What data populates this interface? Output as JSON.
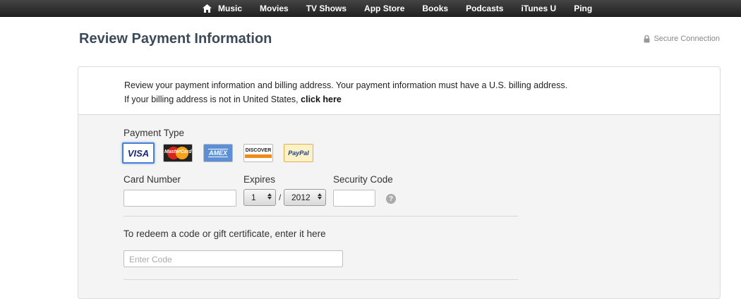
{
  "nav": {
    "items": [
      "Music",
      "Movies",
      "TV Shows",
      "App Store",
      "Books",
      "Podcasts",
      "iTunes U",
      "Ping"
    ]
  },
  "header": {
    "title": "Review Payment Information",
    "secure_label": "Secure Connection"
  },
  "intro": {
    "line1": "Review your payment information and billing address. Your payment information must have a U.S. billing address.",
    "line2_prefix": "If your billing address is not in United States,",
    "line2_link": "click here"
  },
  "payment": {
    "type_label": "Payment Type",
    "cards": [
      {
        "id": "visa",
        "label": "VISA",
        "selected": true
      },
      {
        "id": "mastercard",
        "label": "MasterCard",
        "selected": false
      },
      {
        "id": "amex",
        "label": "AMEX",
        "selected": false
      },
      {
        "id": "discover",
        "label": "DISCOVER",
        "selected": false
      },
      {
        "id": "paypal",
        "label": "PayPal",
        "selected": false
      }
    ],
    "card_number_label": "Card Number",
    "card_number_value": "",
    "expires_label": "Expires",
    "expires_month": "1",
    "expires_separator": "/",
    "expires_year": "2012",
    "security_code_label": "Security Code",
    "security_code_value": "",
    "help_glyph": "?"
  },
  "redeem": {
    "label": "To redeem a code or gift certificate, enter it here",
    "placeholder": "Enter Code"
  },
  "colors": {
    "nav_bg": "#2a2a2a",
    "title": "#3b4a5a",
    "selected_card_border": "#4a7fd6"
  }
}
